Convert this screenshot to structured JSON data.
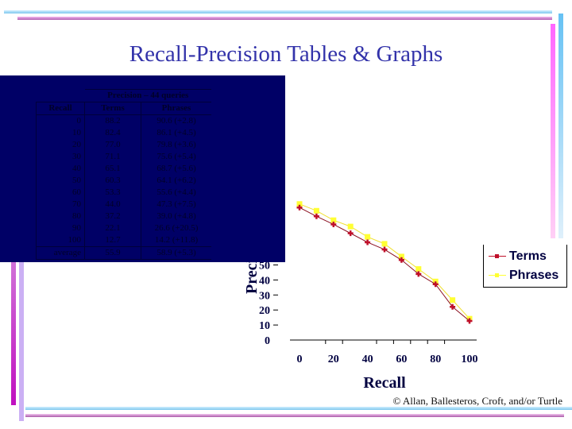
{
  "slide": {
    "title": "Recall-Precision Tables & Graphs",
    "footer": "© Allan, Ballesteros, Croft, and/or Turtle"
  },
  "table": {
    "caption": "Precision – 44 queries",
    "headers": [
      "Recall",
      "Terms",
      "Phrases"
    ],
    "rows": [
      {
        "recall": "0",
        "terms": "88.2",
        "phrases": "90.6 (+2.8)"
      },
      {
        "recall": "10",
        "terms": "82.4",
        "phrases": "86.1 (+4.5)"
      },
      {
        "recall": "20",
        "terms": "77.0",
        "phrases": "79.8 (+3.6)"
      },
      {
        "recall": "30",
        "terms": "71.1",
        "phrases": "75.6 (+5.4)"
      },
      {
        "recall": "40",
        "terms": "65.1",
        "phrases": "68.7 (+5.6)"
      },
      {
        "recall": "50",
        "terms": "60.3",
        "phrases": "64.1 (+6.2)"
      },
      {
        "recall": "60",
        "terms": "53.3",
        "phrases": "55.6 (+4.4)"
      },
      {
        "recall": "70",
        "terms": "44.0",
        "phrases": "47.3 (+7.5)"
      },
      {
        "recall": "80",
        "terms": "37.2",
        "phrases": "39.0 (+4.8)"
      },
      {
        "recall": "90",
        "terms": "22.1",
        "phrases": "26.6 (+20.5)"
      },
      {
        "recall": "100",
        "terms": "12.7",
        "phrases": "14.2 (+11.8)"
      }
    ],
    "average": {
      "recall": "average",
      "terms": "55.9",
      "phrases": "58.9 (+5.3)"
    }
  },
  "chart_data": {
    "type": "line",
    "title": "",
    "xlabel": "Recall",
    "ylabel": "Precision",
    "x": [
      0,
      10,
      20,
      30,
      40,
      50,
      60,
      70,
      80,
      90,
      100
    ],
    "series": [
      {
        "name": "Terms",
        "color": "#c0102a",
        "values": [
          88.2,
          82.4,
          77.0,
          71.1,
          65.1,
          60.3,
          53.3,
          44.0,
          37.2,
          22.1,
          12.7
        ]
      },
      {
        "name": "Phrases",
        "color": "#ffff33",
        "values": [
          90.6,
          86.1,
          79.8,
          75.6,
          68.7,
          64.1,
          55.6,
          47.3,
          39.0,
          26.6,
          14.2
        ]
      }
    ],
    "xticks": [
      0,
      20,
      40,
      60,
      80,
      100
    ],
    "yticks_visible": [
      0,
      10,
      20,
      30,
      40,
      50
    ],
    "xlim": [
      0,
      100
    ],
    "ylim": [
      0,
      100
    ],
    "grid": false,
    "legend": "right"
  }
}
